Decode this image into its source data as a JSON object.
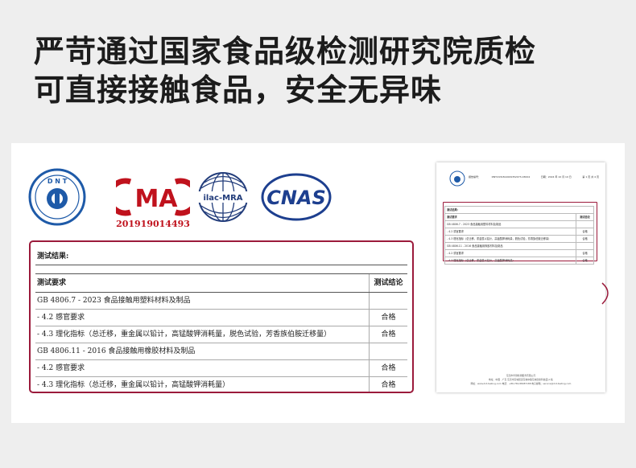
{
  "headline": {
    "line1": "严苛通过国家食品级检测研究院质检",
    "line2": "可直接接触食品，安全无异味"
  },
  "logos": {
    "dnt": "D N T",
    "cma": "MA",
    "cma_number": "201919014493",
    "ilac": "ilac-MRA",
    "cnas": "CNAS"
  },
  "results": {
    "title": "测试结果:",
    "header": {
      "item": "测试要求",
      "conclusion": "测试结论"
    },
    "rows": [
      {
        "item": "GB 4806.7 - 2023 食品接触用塑料材料及制品",
        "conclusion": ""
      },
      {
        "item": "- 4.2  感官要求",
        "conclusion": "合格"
      },
      {
        "item": "- 4.3  理化指标（总迁移，重金属以铅计，高锰酸钾消耗量，脱色试验，芳香族伯胺迁移量）",
        "conclusion": "合格"
      },
      {
        "item": "GB 4806.11 - 2016 食品接触用橡胶材料及制品",
        "conclusion": ""
      },
      {
        "item": "- 4.2  感官要求",
        "conclusion": "合格"
      },
      {
        "item": "- 4.3  理化指标（总迁移，重金属以铅计，高锰酸钾消耗量）",
        "conclusion": "合格"
      }
    ]
  },
  "doc": {
    "report_no": "报告编号：",
    "report_id": "DNT2431812009352073-03004",
    "date": "日期：2024 年 10 月 10 日",
    "page": "第 1 页 共 4 页",
    "title": "测试结果:",
    "header": {
      "item": "测试要求",
      "conclusion": "测试结论"
    },
    "rows": [
      {
        "item": "GB 4806.7 - 2023 食品接触用塑料材料及制品",
        "conclusion": ""
      },
      {
        "item": "- 4.2  感官要求",
        "conclusion": "合格"
      },
      {
        "item": "- 4.3  理化指标（总迁移，重金属以铅计，高锰酸钾消耗量，脱色试验，芳香族伯胺迁移量）",
        "conclusion": "合格"
      },
      {
        "item": "GB 4806.11 - 2016 食品接触用橡胶材料及制品",
        "conclusion": ""
      },
      {
        "item": "- 4.2  感官要求",
        "conclusion": "合格"
      },
      {
        "item": "- 4.3  理化指标（总迁移，重金属以铅计，高锰酸钾消耗量）",
        "conclusion": "合格"
      }
    ],
    "footer1": "东莞市华测检测服务有限公司",
    "footer2": "地址：中国 · 广东 东莞市东城街道东城中路东城创新科技园 A 栋",
    "footer3": "网址：www.dnt-testing.com   电话：+86-769-88087188   电子邮箱：service@dnt-testing.com"
  },
  "colors": {
    "accent_border": "#9b1a3b",
    "cma_red": "#c0121d",
    "dnt_blue": "#1e5aa8",
    "cnas_blue": "#1d3f8f"
  }
}
